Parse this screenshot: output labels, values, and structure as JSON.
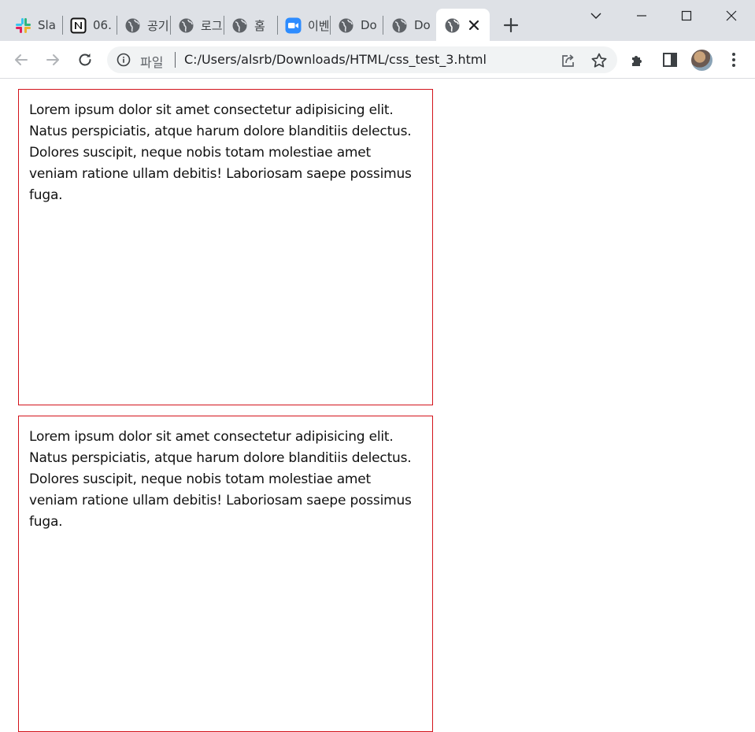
{
  "browser": {
    "tabs": [
      {
        "label": "Sla",
        "icon": "slack-icon"
      },
      {
        "label": "06.",
        "icon": "notion-icon"
      },
      {
        "label": "공기",
        "icon": "globe-icon"
      },
      {
        "label": "로그",
        "icon": "globe-icon"
      },
      {
        "label": "홈",
        "icon": "globe-icon"
      },
      {
        "label": "이벤",
        "icon": "zoom-icon"
      },
      {
        "label": "Do",
        "icon": "globe-icon"
      },
      {
        "label": "Do",
        "icon": "globe-icon"
      }
    ],
    "active_tab": {
      "icon": "globe-icon"
    },
    "address_bar": {
      "scheme_label": "파일",
      "url": "C:/Users/alsrb/Downloads/HTML/css_test_3.html"
    }
  },
  "page": {
    "boxes": [
      {
        "text": "Lorem ipsum dolor sit amet consectetur adipisicing elit. Natus perspiciatis, atque harum dolore blanditiis delectus. Dolores suscipit, neque nobis totam molestiae amet veniam ratione ullam debitis! Laboriosam saepe possimus fuga."
      },
      {
        "text": "Lorem ipsum dolor sit amet consectetur adipisicing elit. Natus perspiciatis, atque harum dolore blanditiis delectus. Dolores suscipit, neque nobis totam molestiae amet veniam ratione ullam debitis! Laboriosam saepe possimus fuga."
      }
    ],
    "border_color": "#d3131b"
  }
}
